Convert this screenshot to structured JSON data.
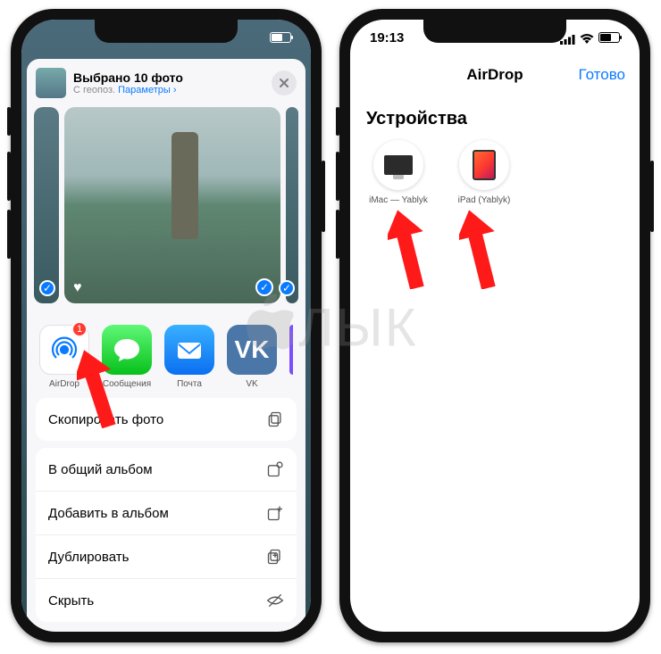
{
  "status": {
    "time": "19:13"
  },
  "left": {
    "header": {
      "title": "Выбрано 10 фото",
      "subtitle_prefix": "С геопоз.",
      "subtitle_link": "Параметры",
      "subtitle_chevron": "›"
    },
    "apps": {
      "airdrop": {
        "label": "AirDrop",
        "badge": "1"
      },
      "messages": {
        "label": "Сообщения"
      },
      "mail": {
        "label": "Почта"
      },
      "vk": {
        "label": "VK",
        "glyph": "VK"
      }
    },
    "actions": {
      "copy": "Скопировать фото",
      "shared_album": "В общий альбом",
      "add_album": "Добавить в альбом",
      "duplicate": "Дублировать",
      "hide": "Скрыть"
    }
  },
  "right": {
    "nav": {
      "title": "AirDrop",
      "done": "Готово"
    },
    "section": "Устройства",
    "devices": {
      "imac": "iMac — Yablyk",
      "ipad": "iPad (Yablyk)"
    }
  },
  "watermark": "ЛЫК"
}
